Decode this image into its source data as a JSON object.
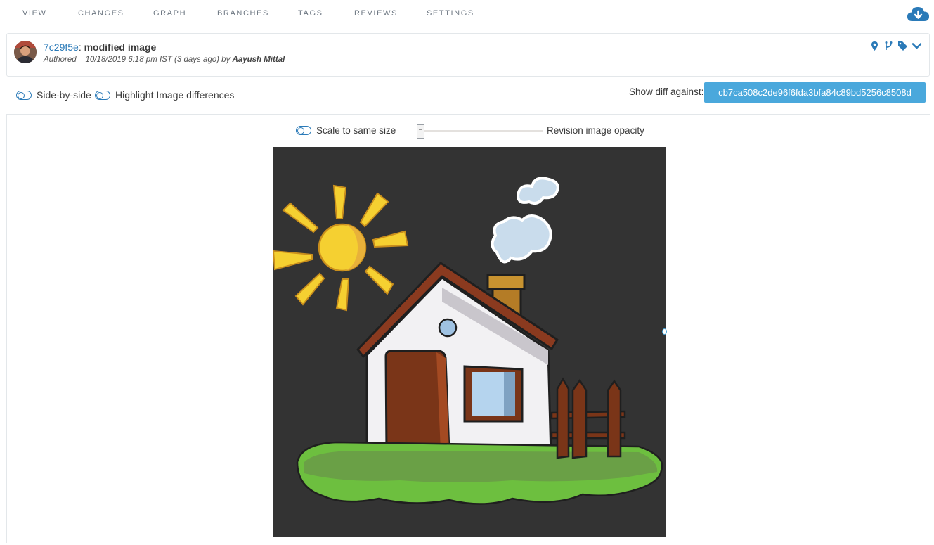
{
  "nav": {
    "tabs": [
      {
        "label": "VIEW"
      },
      {
        "label": "CHANGES"
      },
      {
        "label": "GRAPH"
      },
      {
        "label": "BRANCHES"
      },
      {
        "label": "TAGS"
      },
      {
        "label": "REVIEWS"
      },
      {
        "label": "SETTINGS"
      }
    ],
    "download_icon": "cloud-download-icon"
  },
  "commit": {
    "hash": "7c29f5e",
    "separator": ":",
    "message": "modified image",
    "authored_label": "Authored",
    "datetime": "10/18/2019 6:18 pm IST (3 days ago) by",
    "author": "Aayush Mittal",
    "icons": [
      "map-marker-icon",
      "branch-icon",
      "tag-icon",
      "chevron-down-icon"
    ]
  },
  "options": {
    "side_by_side": "Side-by-side",
    "highlight_differences": "Highlight Image differences",
    "show_diff_label": "Show diff against:",
    "diff_hash": "cb7ca508c2de96f6fda3bfa84c89bd5256c8508d"
  },
  "viewer": {
    "scale_label": "Scale to same size",
    "opacity_label": "Revision image opacity",
    "opacity_value": 0
  },
  "colors": {
    "accent": "#2a7ab8",
    "button": "#4aa8dc",
    "image_bg": "#333333"
  }
}
